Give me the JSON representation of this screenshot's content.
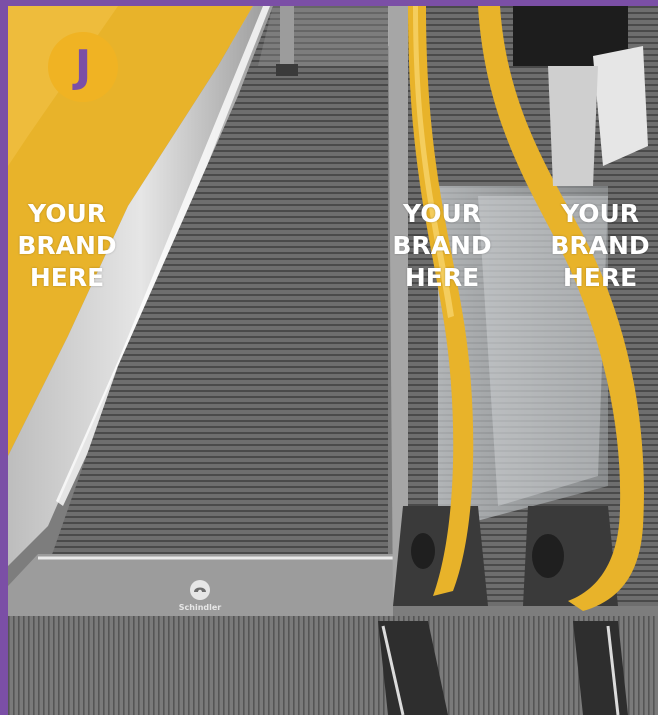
{
  "logo": {
    "letter": "J",
    "bg_color": "#f0b323",
    "fg_color": "#7b4fa6"
  },
  "frame_color": "#7b4fa6",
  "accent_yellow": "#e8b32a",
  "brand_placeholders": [
    {
      "lines": [
        "YOUR",
        "BRAND",
        "HERE"
      ]
    },
    {
      "lines": [
        "YOUR",
        "BRAND",
        "HERE"
      ]
    },
    {
      "lines": [
        "YOUR",
        "BRAND",
        "HERE"
      ]
    }
  ],
  "escalator_brand": {
    "icon": "schindler-logo-icon",
    "text": "Schindler"
  }
}
